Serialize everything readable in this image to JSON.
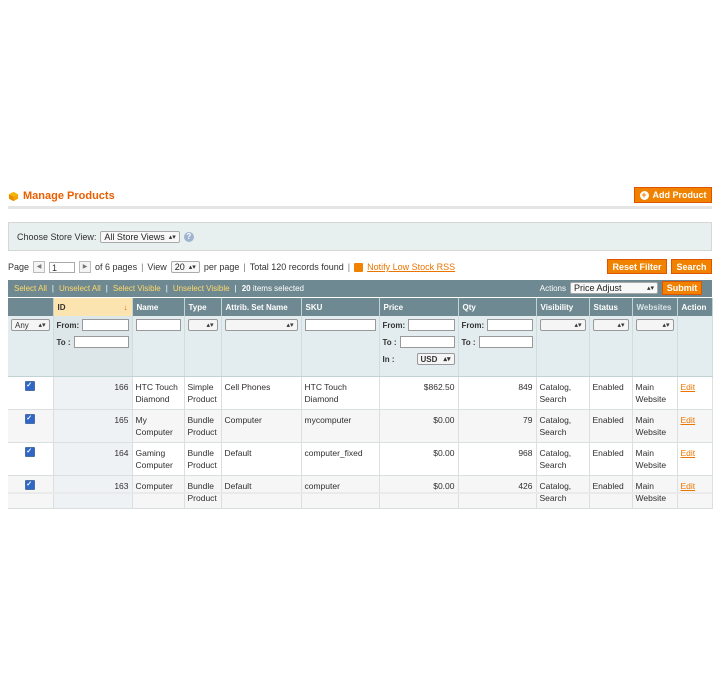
{
  "header": {
    "title": "Manage Products",
    "add_button": "Add Product"
  },
  "store_switcher": {
    "label": "Choose Store View:",
    "selected": "All Store Views"
  },
  "pager": {
    "page_label": "Page",
    "page_value": "1",
    "of_pages": "of 6 pages",
    "view_label": "View",
    "per_page_value": "20",
    "per_page_label": "per page",
    "records_found": "Total 120 records found",
    "rss_link": "Notify Low Stock RSS",
    "reset_filter": "Reset Filter",
    "search": "Search"
  },
  "massaction": {
    "select_all": "Select All",
    "unselect_all": "Unselect All",
    "select_visible": "Select Visible",
    "unselect_visible": "Unselect Visible",
    "selected_count": "20",
    "selected_suffix": "items selected",
    "actions_label": "Actions",
    "action_selected": "Price Adjust",
    "submit": "Submit"
  },
  "columns": [
    "",
    "ID",
    "Name",
    "Type",
    "Attrib. Set Name",
    "SKU",
    "Price",
    "Qty",
    "Visibility",
    "Status",
    "Websites",
    "Action"
  ],
  "filters": {
    "any": "Any",
    "from": "From:",
    "to": "To :",
    "in": "In :",
    "currency": "USD"
  },
  "rows": [
    {
      "id": "166",
      "name": "HTC Touch Diamond",
      "type": "Simple Product",
      "attrib_set": "Cell Phones",
      "sku": "HTC Touch Diamond",
      "price": "$862.50",
      "qty": "849",
      "visibility": "Catalog, Search",
      "status": "Enabled",
      "websites": "Main Website",
      "action": "Edit"
    },
    {
      "id": "165",
      "name": "My Computer",
      "type": "Bundle Product",
      "attrib_set": "Computer",
      "sku": "mycomputer",
      "price": "$0.00",
      "qty": "79",
      "visibility": "Catalog, Search",
      "status": "Enabled",
      "websites": "Main Website",
      "action": "Edit"
    },
    {
      "id": "164",
      "name": "Gaming Computer",
      "type": "Bundle Product",
      "attrib_set": "Default",
      "sku": "computer_fixed",
      "price": "$0.00",
      "qty": "968",
      "visibility": "Catalog, Search",
      "status": "Enabled",
      "websites": "Main Website",
      "action": "Edit"
    },
    {
      "id": "163",
      "name": "Computer",
      "type": "Bundle Product",
      "attrib_set": "Default",
      "sku": "computer",
      "price": "$0.00",
      "qty": "426",
      "visibility": "Catalog, Search",
      "status": "Enabled",
      "websites": "Main Website",
      "action": "Edit"
    }
  ],
  "colors": {
    "accent": "#f18200",
    "title": "#eb5e00",
    "grid_header": "#6f8992",
    "link": "#ea7601"
  }
}
